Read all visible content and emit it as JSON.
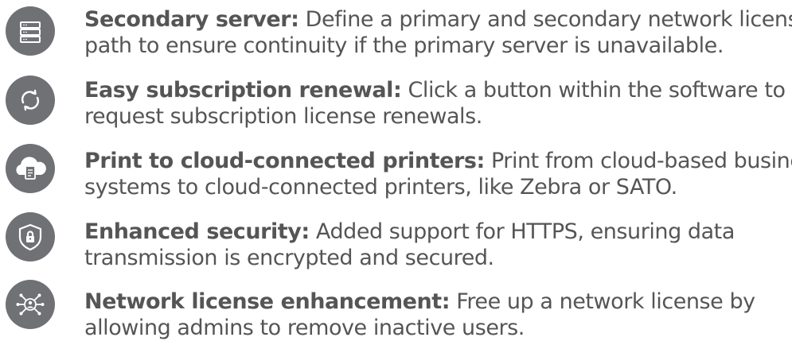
{
  "features": [
    {
      "icon": "server-icon",
      "title": "Secondary server:",
      "line1": "Define a primary and secondary network license",
      "line2": "path to ensure continuity if the primary server is unavailable."
    },
    {
      "icon": "refresh-icon",
      "title": "Easy subscription renewal:",
      "line1": "Click a button within the software to",
      "line2": "request subscription license renewals."
    },
    {
      "icon": "cloud-document-icon",
      "title": "Print to cloud-connected printers:",
      "line1": "Print from cloud-based business",
      "line2": "systems to cloud-connected printers, like Zebra or SATO."
    },
    {
      "icon": "shield-lock-icon",
      "title": "Enhanced security:",
      "line1": "Added support for HTTPS, ensuring data",
      "line2": "transmission is encrypted and secured."
    },
    {
      "icon": "network-user-icon",
      "title": "Network license enhancement:",
      "line1": "Free up a network license by",
      "line2": "allowing admins to remove inactive users."
    }
  ],
  "colors": {
    "icon_background": "#6f7175",
    "icon_foreground": "#ffffff",
    "text": "#555555"
  }
}
